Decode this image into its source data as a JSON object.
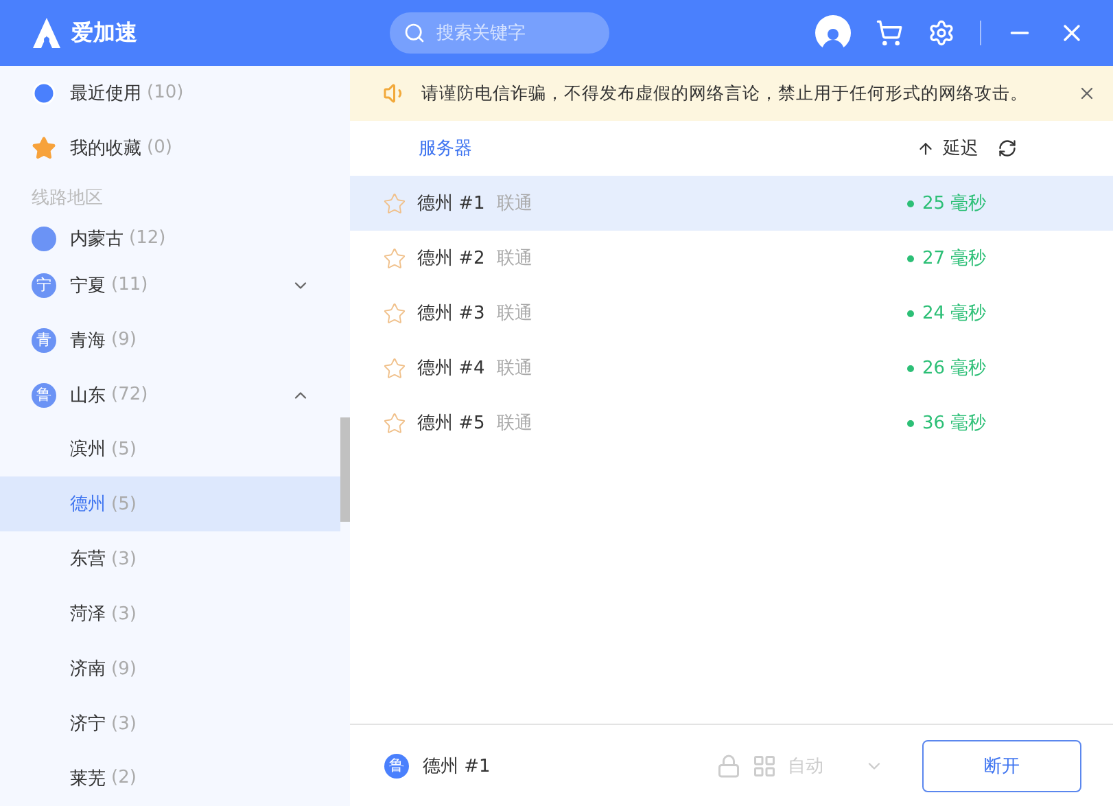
{
  "app": {
    "name": "爱加速"
  },
  "search": {
    "placeholder": "搜索关键字"
  },
  "sidebar": {
    "shortcuts": [
      {
        "kind": "recent",
        "label": "最近使用",
        "count": "(10)"
      },
      {
        "kind": "favorite",
        "label": "我的收藏",
        "count": "(0)"
      }
    ],
    "section_title": "线路地区",
    "regions": [
      {
        "label": "内蒙古",
        "count": "(12)"
      },
      {
        "badge": "宁",
        "label": "宁夏",
        "count": "(11)",
        "expanded": false
      },
      {
        "badge": "青",
        "label": "青海",
        "count": "(9)"
      },
      {
        "badge": "鲁",
        "label": "山东",
        "count": "(72)",
        "expanded": true,
        "children": [
          {
            "label": "滨州",
            "count": "(5)",
            "selected": false
          },
          {
            "label": "德州",
            "count": "(5)",
            "selected": true
          },
          {
            "label": "东营",
            "count": "(3)",
            "selected": false
          },
          {
            "label": "菏泽",
            "count": "(3)",
            "selected": false
          },
          {
            "label": "济南",
            "count": "(9)",
            "selected": false
          },
          {
            "label": "济宁",
            "count": "(3)",
            "selected": false
          },
          {
            "label": "莱芜",
            "count": "(2)",
            "selected": false
          }
        ]
      }
    ]
  },
  "notice": {
    "text": "请谨防电信诈骗，不得发布虚假的网络言论，禁止用于任何形式的网络攻击。"
  },
  "table": {
    "columns": [
      "服务器",
      "延迟"
    ],
    "rows": [
      {
        "name": "德州 #1",
        "carrier": "联通",
        "latency": "25 毫秒",
        "selected": true,
        "favorite": false
      },
      {
        "name": "德州 #2",
        "carrier": "联通",
        "latency": "27 毫秒",
        "selected": false,
        "favorite": false
      },
      {
        "name": "德州 #3",
        "carrier": "联通",
        "latency": "24 毫秒",
        "selected": false,
        "favorite": false
      },
      {
        "name": "德州 #4",
        "carrier": "联通",
        "latency": "26 毫秒",
        "selected": false,
        "favorite": false
      },
      {
        "name": "德州 #5",
        "carrier": "联通",
        "latency": "36 毫秒",
        "selected": false,
        "favorite": false
      }
    ]
  },
  "footer": {
    "badge": "鲁",
    "server": "德州 #1",
    "mode": "自动",
    "button": "断开"
  }
}
